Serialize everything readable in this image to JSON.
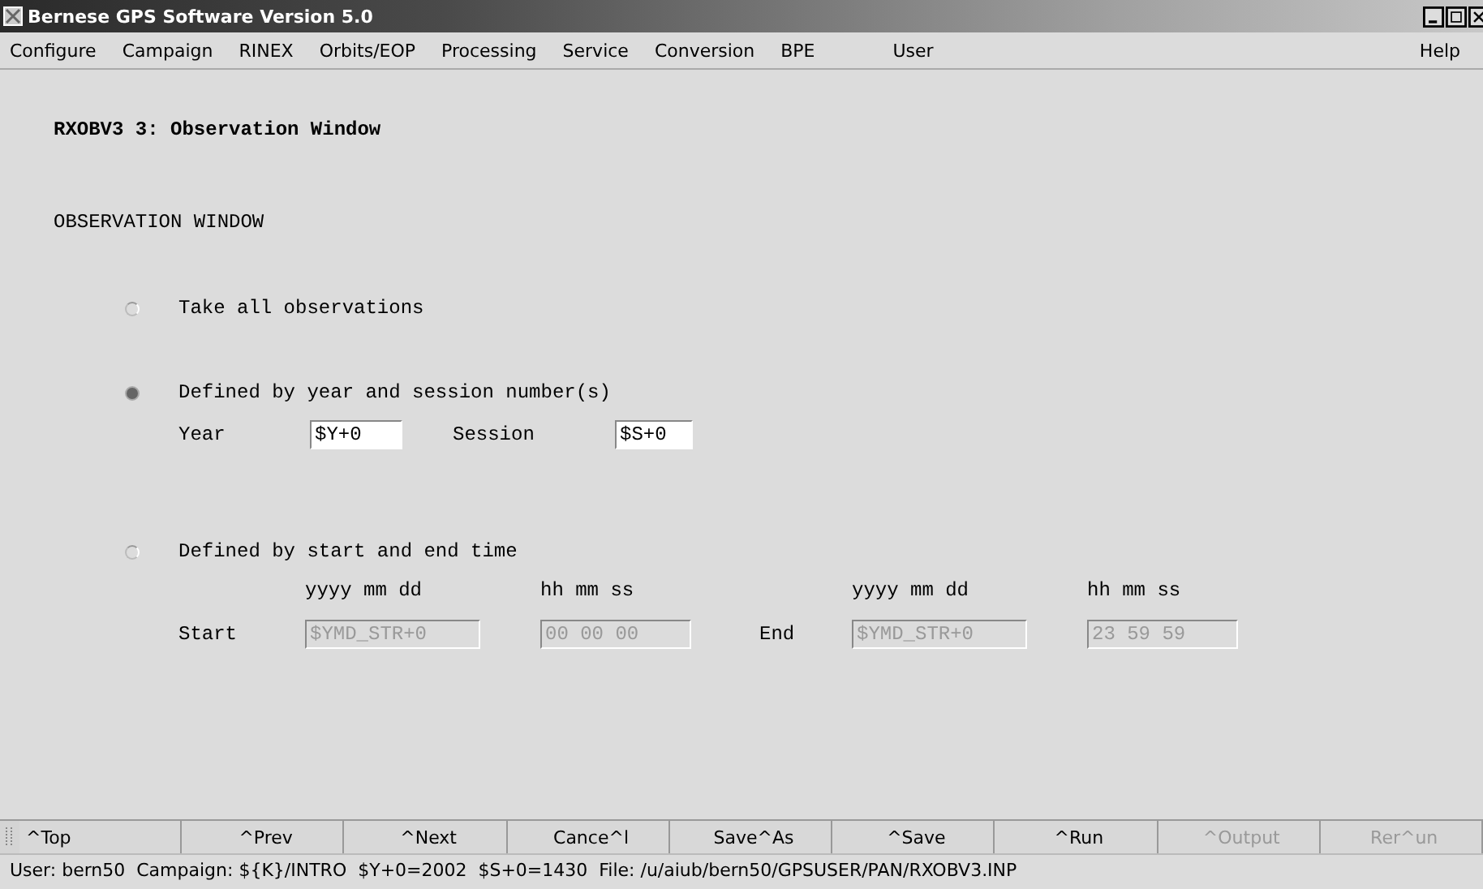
{
  "window": {
    "title": "Bernese GPS Software Version 5.0"
  },
  "menu": [
    "Configure",
    "Campaign",
    "RINEX",
    "Orbits/EOP",
    "Processing",
    "Service",
    "Conversion",
    "BPE",
    "User",
    "Help"
  ],
  "panel": {
    "heading": "RXOBV3 3: Observation Window",
    "section": "OBSERVATION WINDOW",
    "options": [
      {
        "label": "Take all observations",
        "selected": false
      },
      {
        "label": "Defined by year and session number(s)",
        "selected": true
      },
      {
        "label": "Defined by start and end time",
        "selected": false
      }
    ],
    "year": {
      "label": "Year",
      "value": "$Y+0"
    },
    "session": {
      "label": "Session",
      "value": "$S+0"
    },
    "headers": [
      "yyyy mm dd",
      "hh mm ss",
      "yyyy mm dd",
      "hh mm ss"
    ],
    "start": {
      "label": "Start",
      "date": "$YMD_STR+0",
      "time": "00 00 00",
      "disabled": true
    },
    "end": {
      "label": "End",
      "date": "$YMD_STR+0",
      "time": "23 59 59",
      "disabled": true
    }
  },
  "buttons": [
    {
      "label": "^Top",
      "disabled": false
    },
    {
      "label": "^Prev",
      "disabled": false
    },
    {
      "label": "^Next",
      "disabled": false
    },
    {
      "label": "Cance^l",
      "disabled": false
    },
    {
      "label": "Save^As",
      "disabled": false
    },
    {
      "label": "^Save",
      "disabled": false
    },
    {
      "label": "^Run",
      "disabled": false
    },
    {
      "label": "^Output",
      "disabled": true
    },
    {
      "label": "Rer^un",
      "disabled": true
    }
  ],
  "status_bar": "User: bern50  Campaign: ${K}/INTRO  $Y+0=2002  $S+0=1430  File: /u/aiub/bern50/GPSUSER/PAN/RXOBV3.INP"
}
